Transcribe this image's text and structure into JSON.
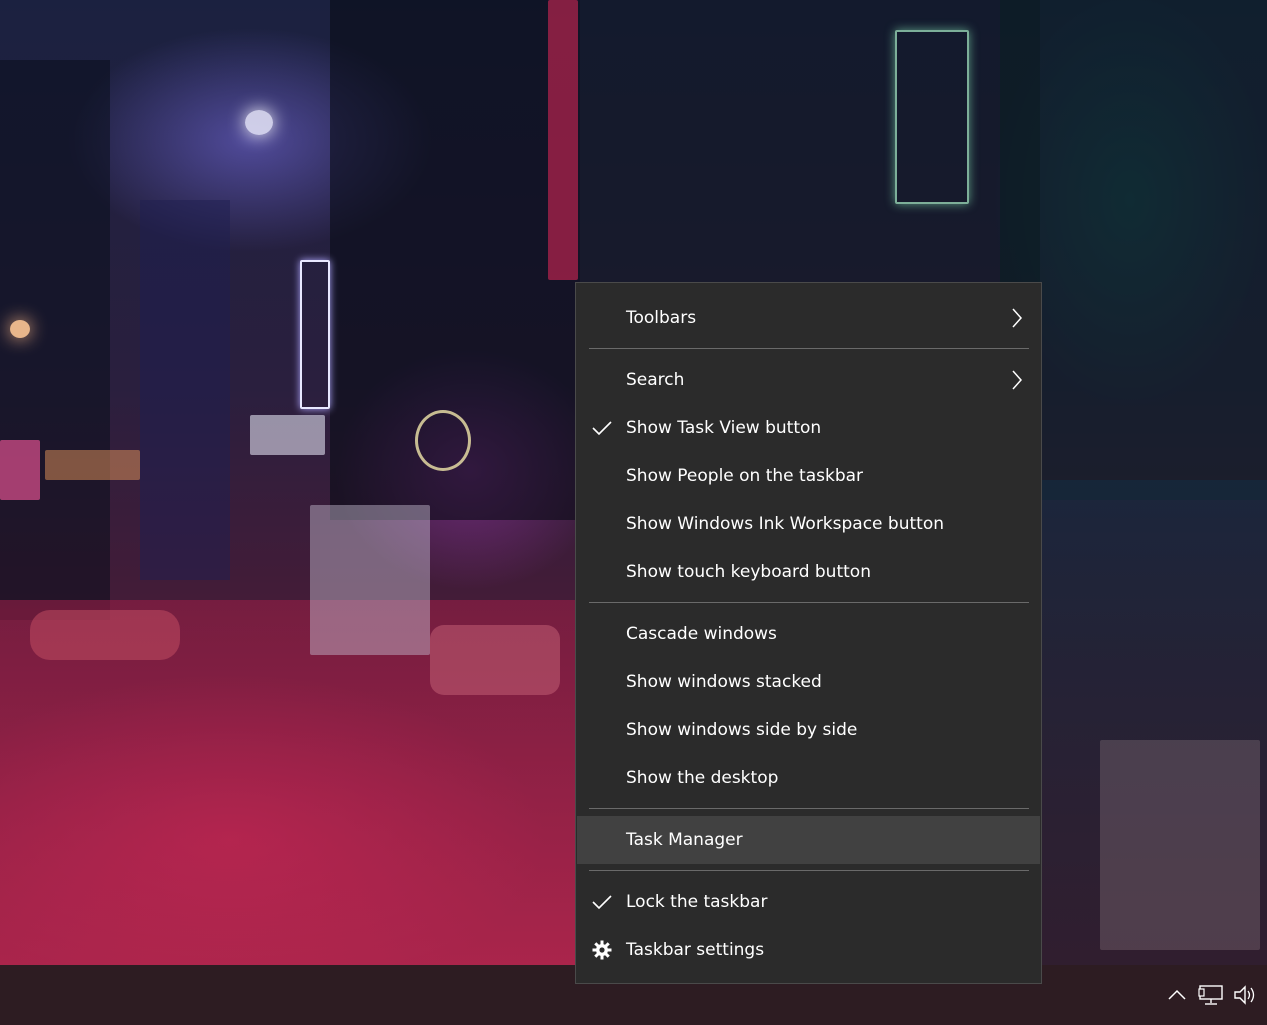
{
  "context_menu": {
    "items": [
      {
        "label": "Toolbars"
      },
      {
        "label": "Search"
      },
      {
        "label": "Show Task View button"
      },
      {
        "label": "Show People on the taskbar"
      },
      {
        "label": "Show Windows Ink Workspace button"
      },
      {
        "label": "Show touch keyboard button"
      },
      {
        "label": "Cascade windows"
      },
      {
        "label": "Show windows stacked"
      },
      {
        "label": "Show windows side by side"
      },
      {
        "label": "Show the desktop"
      },
      {
        "label": "Task Manager"
      },
      {
        "label": "Lock the taskbar"
      },
      {
        "label": "Taskbar settings"
      }
    ],
    "highlighted_item": "Task Manager",
    "background_color": "#2b2b2b",
    "highlight_color": "#414141"
  },
  "taskbar": {
    "background_color": "#2d1c22",
    "tray_icons": [
      "chevron-up-icon",
      "network-icon",
      "volume-icon"
    ]
  },
  "icons": {
    "chevron_right": "chevron-right-icon",
    "check": "checkmark-icon",
    "gear": "gear-icon"
  }
}
